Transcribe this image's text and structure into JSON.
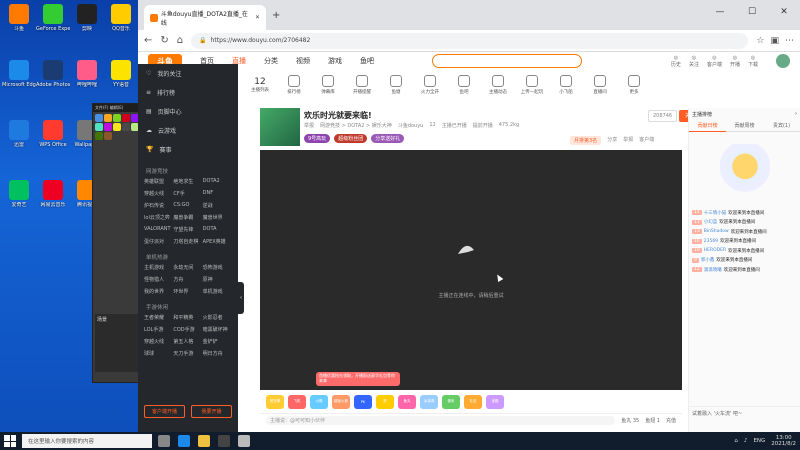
{
  "desktop": {
    "icons": [
      {
        "label": "斗鱼",
        "color": "#ff7a00"
      },
      {
        "label": "GeForce Experience",
        "color": "#3c3"
      },
      {
        "label": "剪映",
        "color": "#222"
      },
      {
        "label": "QQ音乐",
        "color": "#ffcc00"
      },
      {
        "label": "Microsoft Edge",
        "color": "#1b8ae8"
      },
      {
        "label": "Adobe Photoshop",
        "color": "#1b3b73"
      },
      {
        "label": "哔哩哔哩",
        "color": "#ff5c8a"
      },
      {
        "label": "YY语音",
        "color": "#fce400"
      },
      {
        "label": "迅雷",
        "color": "#1f7ae0"
      },
      {
        "label": "WPS Office",
        "color": "#ff3a2f"
      },
      {
        "label": "Wallpaper",
        "color": "#777"
      },
      {
        "label": "Steam",
        "color": "#1a2a44"
      },
      {
        "label": "爱奇艺",
        "color": "#00c060"
      },
      {
        "label": "网易云音乐",
        "color": "#e02"
      },
      {
        "label": "腾讯视频",
        "color": "#ff8800"
      },
      {
        "label": "GeForce",
        "color": "#3a3"
      }
    ]
  },
  "mini_window": {
    "title": "文件(F) 编辑(E)",
    "pane_label": "场景"
  },
  "browser": {
    "tab_title": "斗鱼douyu直播_DOTA2直播_在线",
    "url": "https://www.douyu.com/2706482",
    "win_controls": [
      "—",
      "☐",
      "✕"
    ]
  },
  "site": {
    "logo": "斗鱼",
    "nav": [
      "首页",
      "直播",
      "分类",
      "视频",
      "游戏",
      "鱼吧"
    ],
    "active_nav": "直播",
    "header_icons": [
      "历史",
      "关注",
      "客户端",
      "开播",
      "下载"
    ],
    "sidebar": {
      "top_items": [
        "我的关注",
        "排行榜",
        "页脚中心",
        "云游戏",
        "赛事"
      ],
      "section1": "网游竞技",
      "grid1": [
        "英雄联盟",
        "绝地求生",
        "DOTA2",
        "穿越火线",
        "CF手",
        "DNF",
        "炉石传说",
        "CS:GO",
        "逆战",
        "lol云顶之弈",
        "魔兽争霸",
        "魔兽世界",
        "VALORANT",
        "守望先锋",
        "DOTA",
        "蛋仔派对",
        "刀塔自走棋",
        "APEX英雄"
      ],
      "section2": "单机热游",
      "grid2": [
        "主机游戏",
        "永劫无间",
        "恐怖游戏",
        "怪物猎人",
        "方舟",
        "原神",
        "我的世界",
        "环世界",
        "单机游戏"
      ],
      "section3": "手游休闲",
      "grid3": [
        "王者荣耀",
        "和平精英",
        "火影忍者",
        "LOL手游",
        "COD手游",
        "暗黑破坏神",
        "穿越火线",
        "第五人格",
        "金铲铲",
        "球球",
        "天刀手游",
        "明日方舟"
      ],
      "btn_open": "客户端开播",
      "btn_open2": "我要开播"
    },
    "categories": {
      "count": "12",
      "count_label": "主播列表",
      "items": [
        "主播列表",
        "排行榜",
        "弹幕库",
        "开播提醒",
        "鱼塘",
        "火力全开",
        "鱼吧",
        "主播动态",
        "上传一起玩",
        "小飞船",
        "直播间",
        "更多"
      ]
    },
    "streamer": {
      "title": "欢乐时光就要来临!",
      "meta": [
        "举报",
        "网游竞技 > DOTA2 > 娱乐大神",
        "斗鱼douyu",
        "12",
        "主播已开播",
        "提前开播",
        "475.2kg"
      ],
      "tags": [
        {
          "text": "9号高玩",
          "color": "#8e44ad"
        },
        {
          "text": "超级粉丝团",
          "color": "#c0392b"
        },
        {
          "text": "分享送好礼",
          "color": "#9b59b6"
        }
      ],
      "follow_count": "208746",
      "follow_label": "关注",
      "top_right": [
        "月排第3名",
        "分享",
        "举报",
        "客户端"
      ]
    },
    "video": {
      "status_text": "主播正在连线中，请稍后重试"
    },
    "popup_text": "首播优惠抢先领取，开播即送豪华礼包等你来拿",
    "gifts": [
      {
        "name": "荧光棒",
        "color": "#ffcc33"
      },
      {
        "name": "飞机",
        "color": "#ff6666"
      },
      {
        "name": "火箭",
        "color": "#66ccff"
      },
      {
        "name": "超级火箭",
        "color": "#ff9966"
      },
      {
        "name": "PK",
        "color": "#3366ff"
      },
      {
        "name": "赞",
        "color": "#ffcc00"
      },
      {
        "name": "鱼丸",
        "color": "#ff66aa"
      },
      {
        "name": "冰淇淋",
        "color": "#99ccff"
      },
      {
        "name": "佛系",
        "color": "#66cc66"
      },
      {
        "name": "礼包",
        "color": "#ffaa33"
      },
      {
        "name": "宝箱",
        "color": "#cc99ff"
      }
    ],
    "bottom_bar": {
      "input_placeholder": "主播说：@可可知小伙伴",
      "items": [
        "鱼丸 35",
        "鱼翅 1",
        "充值"
      ]
    },
    "chat": {
      "header": "主播排榜",
      "tabs": [
        "贡献日榜",
        "贡献周榜",
        "贵宾(1)"
      ],
      "messages": [
        {
          "lv": "14",
          "name": "十三情小猫",
          "text": "欢迎来到本直播间"
        },
        {
          "lv": "11",
          "name": "小幻蓝",
          "text": "欢迎来到本直播间"
        },
        {
          "lv": "13",
          "name": "BinShadow",
          "text": "欢迎来到本直播间"
        },
        {
          "lv": "16",
          "name": "23569",
          "text": "欢迎来到本直播间"
        },
        {
          "lv": "10",
          "name": "HERODER",
          "text": "欢迎来到本直播间"
        },
        {
          "lv": "9",
          "name": "郭小鑫",
          "text": "欢迎来到本直播间"
        },
        {
          "lv": "12",
          "name": "潇潇晓曦",
          "text": "欢迎来到本直播间"
        }
      ],
      "footer": "试着融入 '火车流' 吧~"
    }
  },
  "taskbar": {
    "search_placeholder": "在这里输入你要搜索的内容",
    "lang": "ENG",
    "time": "13:00",
    "date": "2021/8/2",
    "apps": [
      {
        "name": "task-view",
        "color": "#888"
      },
      {
        "name": "edge",
        "color": "#1b8ae8"
      },
      {
        "name": "explorer",
        "color": "#f0c040"
      },
      {
        "name": "app3",
        "color": "#444"
      },
      {
        "name": "app4",
        "color": "#bbb"
      }
    ]
  }
}
